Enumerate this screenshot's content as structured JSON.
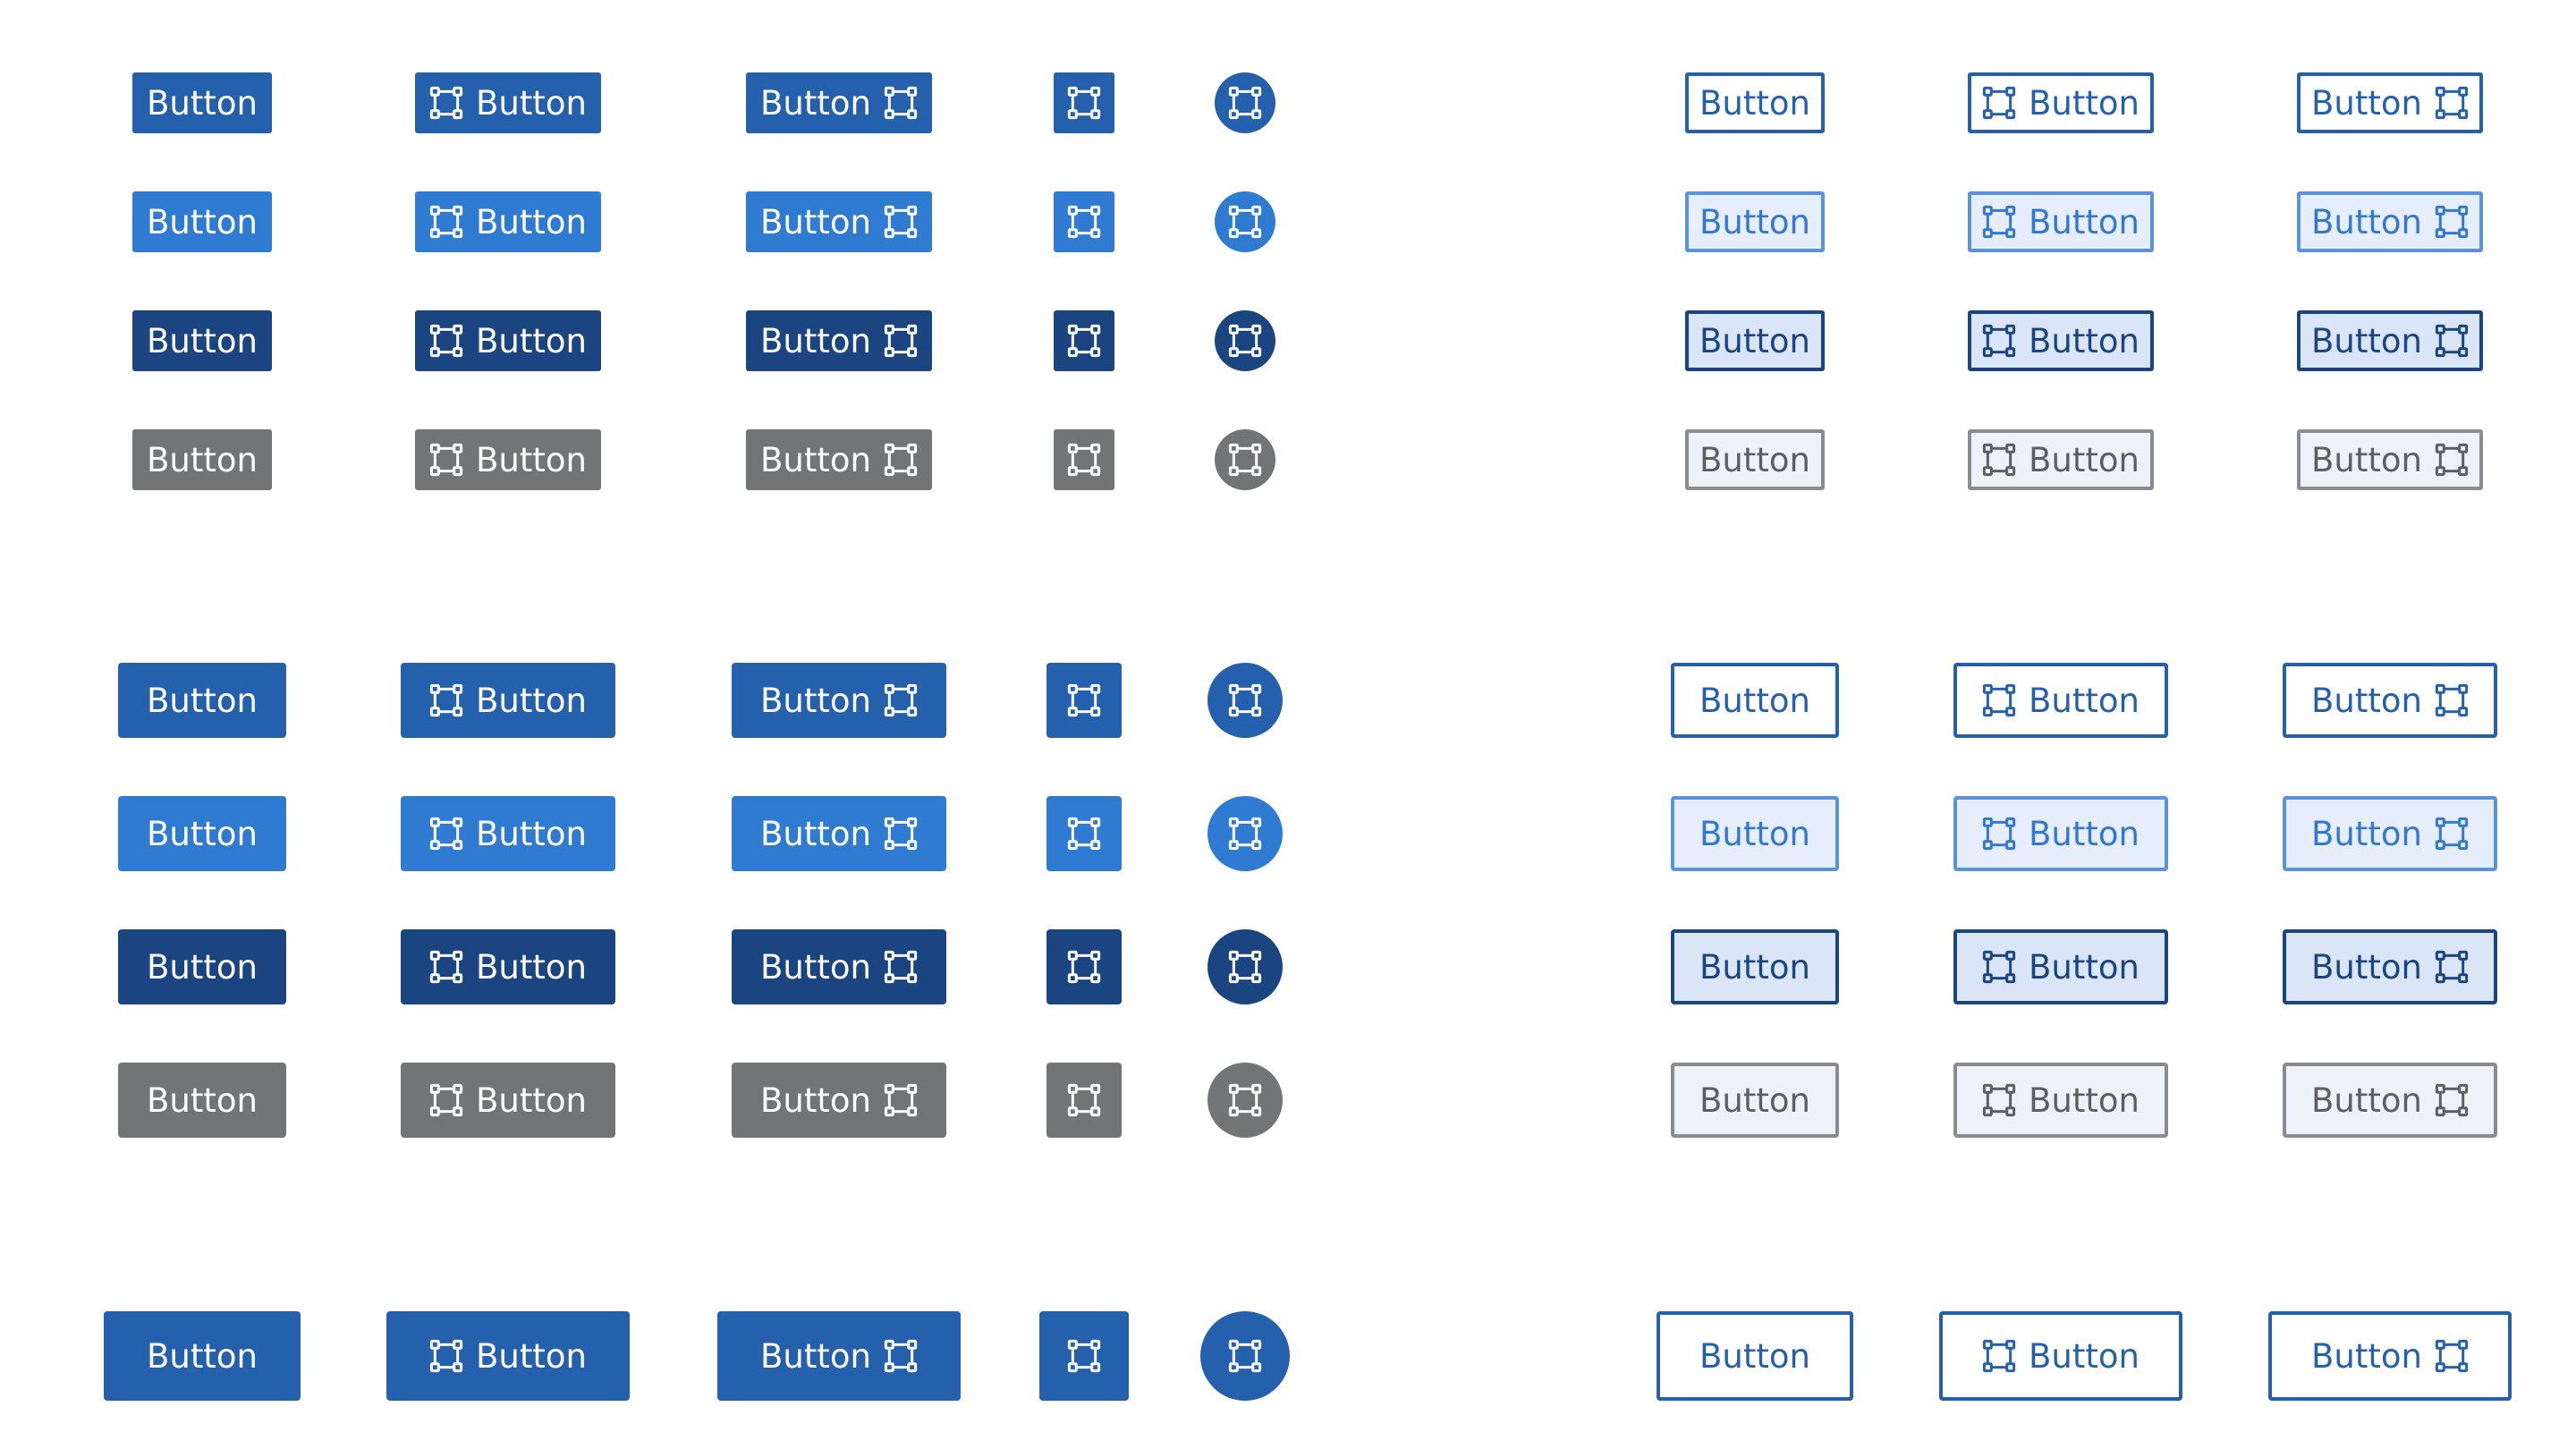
{
  "button_label": "Button",
  "icon_name": "bounding-box-icon",
  "colors": {
    "primary": "#2460ab",
    "hover": "#2f7bd1",
    "active": "#1a4581",
    "disabled": "#737476",
    "outline_text": "#2460ab",
    "outline_hover_border": "#5a93d8",
    "outline_hover_bg": "#e6eefb",
    "outline_hover_text": "#3377cf",
    "outline_active_border": "#1a4581",
    "outline_active_bg": "#dbe5f8",
    "outline_active_text": "#1a4581",
    "outline_disabled_border": "#8a8b8d",
    "outline_disabled_bg": "#eef1f8",
    "outline_disabled_text": "#5d5e60",
    "page_background": "#ffffff"
  },
  "sizes": [
    "small",
    "medium",
    "large"
  ],
  "states_per_size": {
    "small": [
      "default",
      "hover",
      "active",
      "disabled"
    ],
    "medium": [
      "default",
      "hover",
      "active",
      "disabled"
    ],
    "large": [
      "default"
    ]
  },
  "variants": {
    "solid": [
      "text",
      "icon-left",
      "icon-right",
      "icon-square",
      "icon-circle"
    ],
    "outline": [
      "text",
      "icon-left",
      "icon-right"
    ]
  }
}
